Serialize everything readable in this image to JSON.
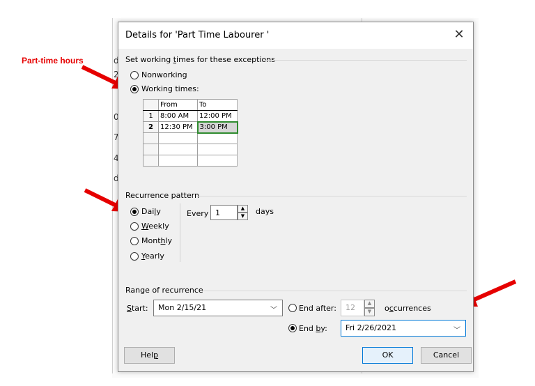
{
  "annotation": {
    "label": "Part-time hours",
    "color": "#e60000"
  },
  "background_fragments": [
    "d",
    "d",
    "2",
    ":",
    "0",
    "7",
    "4"
  ],
  "dialog": {
    "title": "Details for 'Part Time Labourer '",
    "close_icon": "close-icon",
    "exceptions_group": {
      "label_pre": "Set working ",
      "label_ul": "t",
      "label_post": "imes for these exceptions",
      "nonworking": "Nonworking",
      "working_times": "Working times:",
      "selected": "working_times"
    },
    "times_table": {
      "headers": [
        "From",
        "To"
      ],
      "rows": [
        {
          "num": "1",
          "from": "8:00 AM",
          "to": "12:00 PM"
        },
        {
          "num": "2",
          "from": "12:30 PM",
          "to": "3:00 PM"
        },
        {
          "num": "",
          "from": "",
          "to": ""
        },
        {
          "num": "",
          "from": "",
          "to": ""
        },
        {
          "num": "",
          "from": "",
          "to": ""
        }
      ]
    },
    "recurrence": {
      "label": "Recurrence pattern",
      "daily_pre": "Dai",
      "daily_ul": "l",
      "daily_post": "y",
      "weekly_ul": "W",
      "weekly_post": "eekly",
      "monthly_pre": "Mont",
      "monthly_ul": "h",
      "monthly_post": "ly",
      "yearly_ul": "Y",
      "yearly_post": "early",
      "selected": "daily",
      "every_label": "Every",
      "every_value": "1",
      "days_label": "days"
    },
    "range": {
      "label": "Range of recurrence",
      "start_ul": "S",
      "start_post": "tart:",
      "start_value": "Mon 2/15/21",
      "end_after_label": "End after:",
      "occurrences_value": "12",
      "occ_pre": "o",
      "occ_ul": "c",
      "occ_post": "currences",
      "end_by_pre": "End ",
      "end_by_ul": "b",
      "end_by_post": "y:",
      "end_by_value": "Fri 2/26/2021",
      "selected": "end_by"
    },
    "buttons": {
      "help_pre": "Hel",
      "help_ul": "p",
      "ok": "OK",
      "cancel": "Cancel"
    }
  }
}
